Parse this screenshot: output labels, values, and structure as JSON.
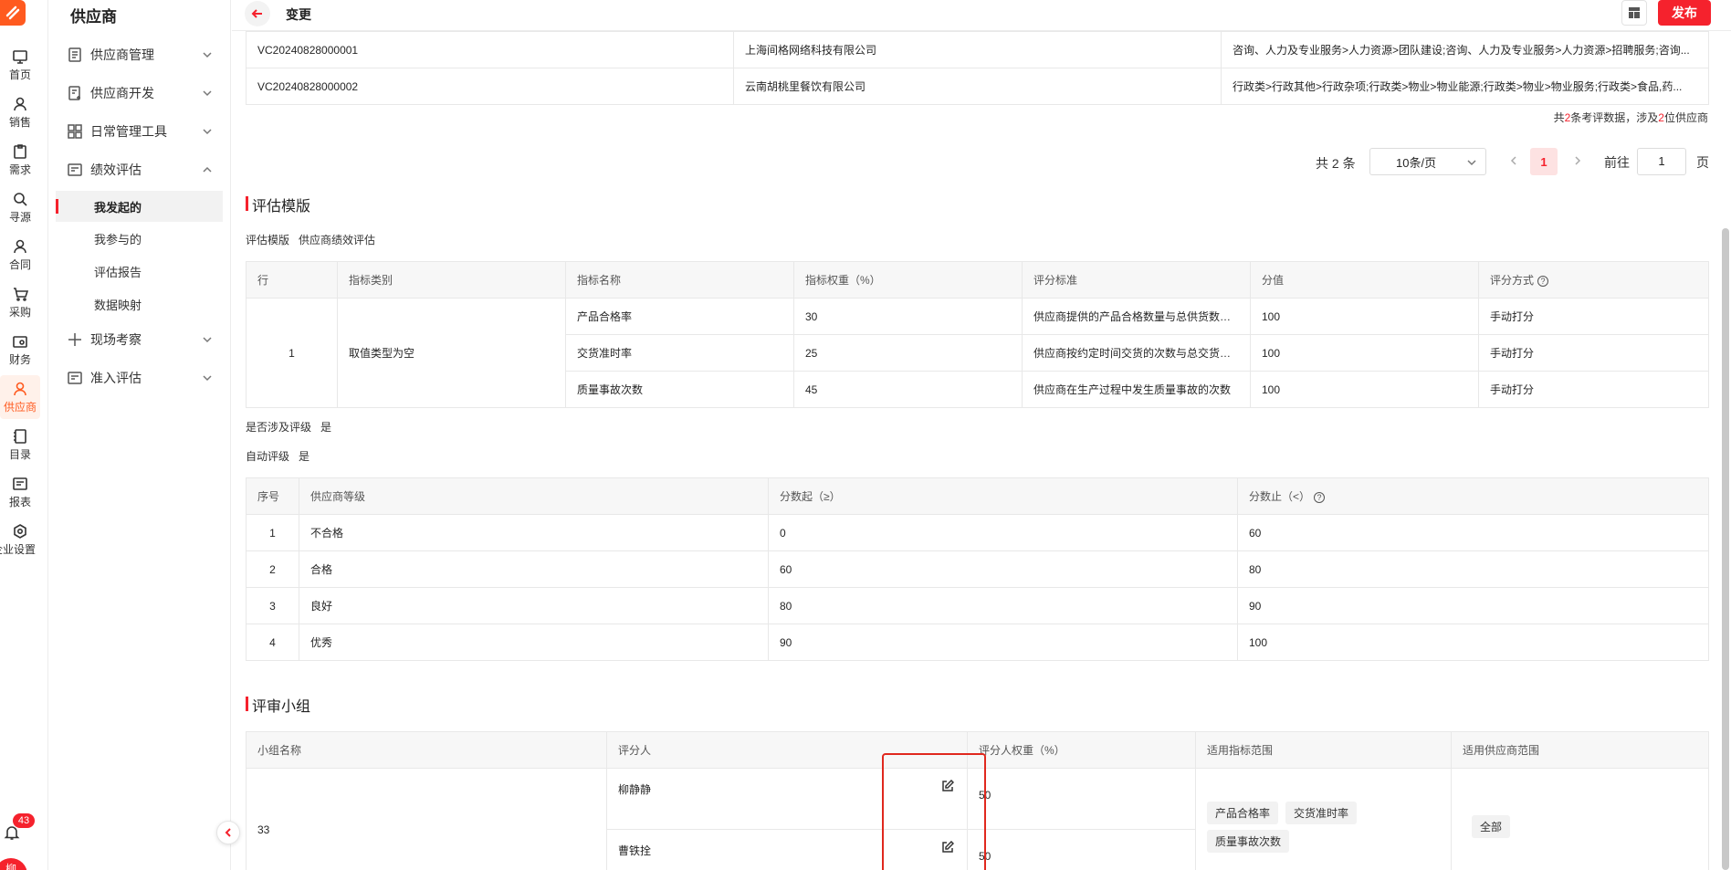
{
  "rail": {
    "items": [
      {
        "label": "首页",
        "icon": "monitor-icon"
      },
      {
        "label": "销售",
        "icon": "person-icon"
      },
      {
        "label": "需求",
        "icon": "clipboard-icon"
      },
      {
        "label": "寻源",
        "icon": "search-icon"
      },
      {
        "label": "合同",
        "icon": "person-icon"
      },
      {
        "label": "采购",
        "icon": "cart-icon"
      },
      {
        "label": "财务",
        "icon": "wallet-icon"
      },
      {
        "label": "供应商",
        "icon": "supplier-icon"
      },
      {
        "label": "目录",
        "icon": "book-icon"
      },
      {
        "label": "报表",
        "icon": "report-icon"
      },
      {
        "label": "企业设置",
        "icon": "hexagon-gear-icon"
      }
    ],
    "notification_count": "43",
    "avatar_text": "柳"
  },
  "menu": {
    "title": "供应商",
    "items": [
      {
        "label": "供应商管理"
      },
      {
        "label": "供应商开发"
      },
      {
        "label": "日常管理工具"
      },
      {
        "label": "绩效评估"
      },
      {
        "label": "现场考察"
      },
      {
        "label": "准入评估"
      }
    ],
    "sub_items": [
      {
        "label": "我发起的"
      },
      {
        "label": "我参与的"
      },
      {
        "label": "评估报告"
      },
      {
        "label": "数据映射"
      }
    ]
  },
  "header": {
    "title": "变更",
    "publish_label": "发布"
  },
  "supplier_table": {
    "rows": [
      {
        "code": "VC20240828000001",
        "name": "上海间格网络科技有限公司",
        "category": "咨询、人力及专业服务>人力资源>团队建设;咨询、人力及专业服务>人力资源>招聘服务;咨询..."
      },
      {
        "code": "VC20240828000002",
        "name": "云南胡桃里餐饮有限公司",
        "category": "行政类>行政其他>行政杂项;行政类>物业>物业能源;行政类>物业>物业服务;行政类>食品,药..."
      }
    ],
    "summary_prefix": "共",
    "summary_count": "2",
    "summary_mid": "条考评数据，涉及",
    "summary_suppliers": "2",
    "summary_suffix": "位供应商"
  },
  "pager": {
    "total": "共 2 条",
    "page_size": "10条/页",
    "current_page": "1",
    "goto_label": "前往",
    "goto_value": "1",
    "page_unit": "页"
  },
  "template_section": {
    "title": "评估模版",
    "template_label": "评估模版",
    "template_value": "供应商绩效评估",
    "columns": [
      "行",
      "指标类别",
      "指标名称",
      "指标权重（%）",
      "评分标准",
      "分值",
      "评分方式"
    ],
    "row_no": "1",
    "category": "取值类型为空",
    "rows": [
      {
        "name": "产品合格率",
        "weight": "30",
        "standard": "供应商提供的产品合格数量与总供货数量的比例",
        "score": "100",
        "method": "手动打分"
      },
      {
        "name": "交货准时率",
        "weight": "25",
        "standard": "供应商按约定时间交货的次数与总交货次数的比例",
        "score": "100",
        "method": "手动打分"
      },
      {
        "name": "质量事故次数",
        "weight": "45",
        "standard": "供应商在生产过程中发生质量事故的次数",
        "score": "100",
        "method": "手动打分"
      }
    ],
    "involve_label": "是否涉及评级",
    "involve_value": "是",
    "auto_label": "自动评级",
    "auto_value": "是"
  },
  "grade_table": {
    "columns": [
      "序号",
      "供应商等级",
      "分数起（≥）",
      "分数止（<）"
    ],
    "rows": [
      {
        "no": "1",
        "grade": "不合格",
        "from": "0",
        "to": "60"
      },
      {
        "no": "2",
        "grade": "合格",
        "from": "60",
        "to": "80"
      },
      {
        "no": "3",
        "grade": "良好",
        "from": "80",
        "to": "90"
      },
      {
        "no": "4",
        "grade": "优秀",
        "from": "90",
        "to": "100"
      }
    ]
  },
  "review_section": {
    "title": "评审小组",
    "columns": [
      "小组名称",
      "评分人",
      "评分人权重（%）",
      "适用指标范围",
      "适用供应商范围"
    ],
    "group_name": "33",
    "reviewers": [
      {
        "name": "柳静静",
        "weight": "50"
      },
      {
        "name": "曹铁拴",
        "weight": "50"
      }
    ],
    "indicator_tags": [
      "产品合格率",
      "交货准时率",
      "质量事故次数"
    ],
    "supplier_scope": "全部"
  },
  "colors": {
    "accent": "#f5222d",
    "brand": "#ff5a1f"
  }
}
